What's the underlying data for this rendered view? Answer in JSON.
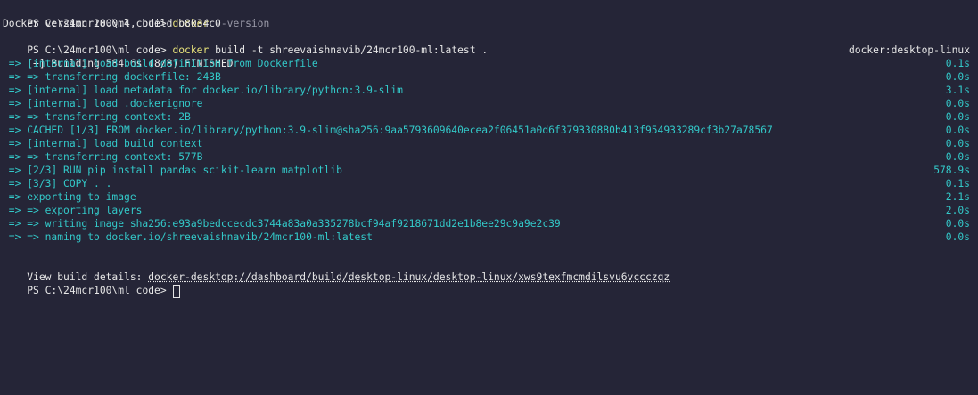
{
  "lines": {
    "l1": {
      "prompt": "PS C:\\24mcr100\\ml code> ",
      "cmd": "docker",
      "args": " --version"
    },
    "l2": {
      "text": "Docker version 28.0.4, build b8034c0"
    },
    "l3": {
      "prompt": "PS C:\\24mcr100\\ml code> ",
      "cmd": "docker",
      "args": " build -t shreevaishnavib/24mcr100-ml:latest ."
    },
    "l4": {
      "text": "[+] Building 584.6s (8/8) FINISHED",
      "right": "docker:desktop-linux"
    }
  },
  "steps": [
    {
      "text": " => [internal] load build definition from Dockerfile",
      "time": "0.1s"
    },
    {
      "text": " => => transferring dockerfile: 243B",
      "time": "0.0s"
    },
    {
      "text": " => [internal] load metadata for docker.io/library/python:3.9-slim",
      "time": "3.1s"
    },
    {
      "text": " => [internal] load .dockerignore",
      "time": "0.0s"
    },
    {
      "text": " => => transferring context: 2B",
      "time": "0.0s"
    },
    {
      "text": " => CACHED [1/3] FROM docker.io/library/python:3.9-slim@sha256:9aa5793609640ecea2f06451a0d6f379330880b413f954933289cf3b27a78567",
      "time": "0.0s"
    },
    {
      "text": " => [internal] load build context",
      "time": "0.0s"
    },
    {
      "text": " => => transferring context: 577B",
      "time": "0.0s"
    },
    {
      "text": " => [2/3] RUN pip install pandas scikit-learn matplotlib",
      "time": "578.9s"
    },
    {
      "text": " => [3/3] COPY . .",
      "time": "0.1s"
    },
    {
      "text": " => exporting to image",
      "time": "2.1s"
    },
    {
      "text": " => => exporting layers",
      "time": "2.0s"
    },
    {
      "text": " => => writing image sha256:e93a9bedccecdc3744a83a0a335278bcf94af9218671dd2e1b8ee29c9a9e2c39",
      "time": "0.0s"
    },
    {
      "text": " => => naming to docker.io/shreevaishnavib/24mcr100-ml:latest",
      "time": "0.0s"
    }
  ],
  "details": {
    "label": "View build details: ",
    "link": "docker-desktop://dashboard/build/desktop-linux/desktop-linux/xws9texfmcmdilsvu6vccczqz"
  },
  "final_prompt": "PS C:\\24mcr100\\ml code> ",
  "colors": {
    "background": "#252537",
    "command": "#e8e37a",
    "output": "#33c9c9",
    "text": "#e6e6e6",
    "argument": "#9a9aa8"
  }
}
